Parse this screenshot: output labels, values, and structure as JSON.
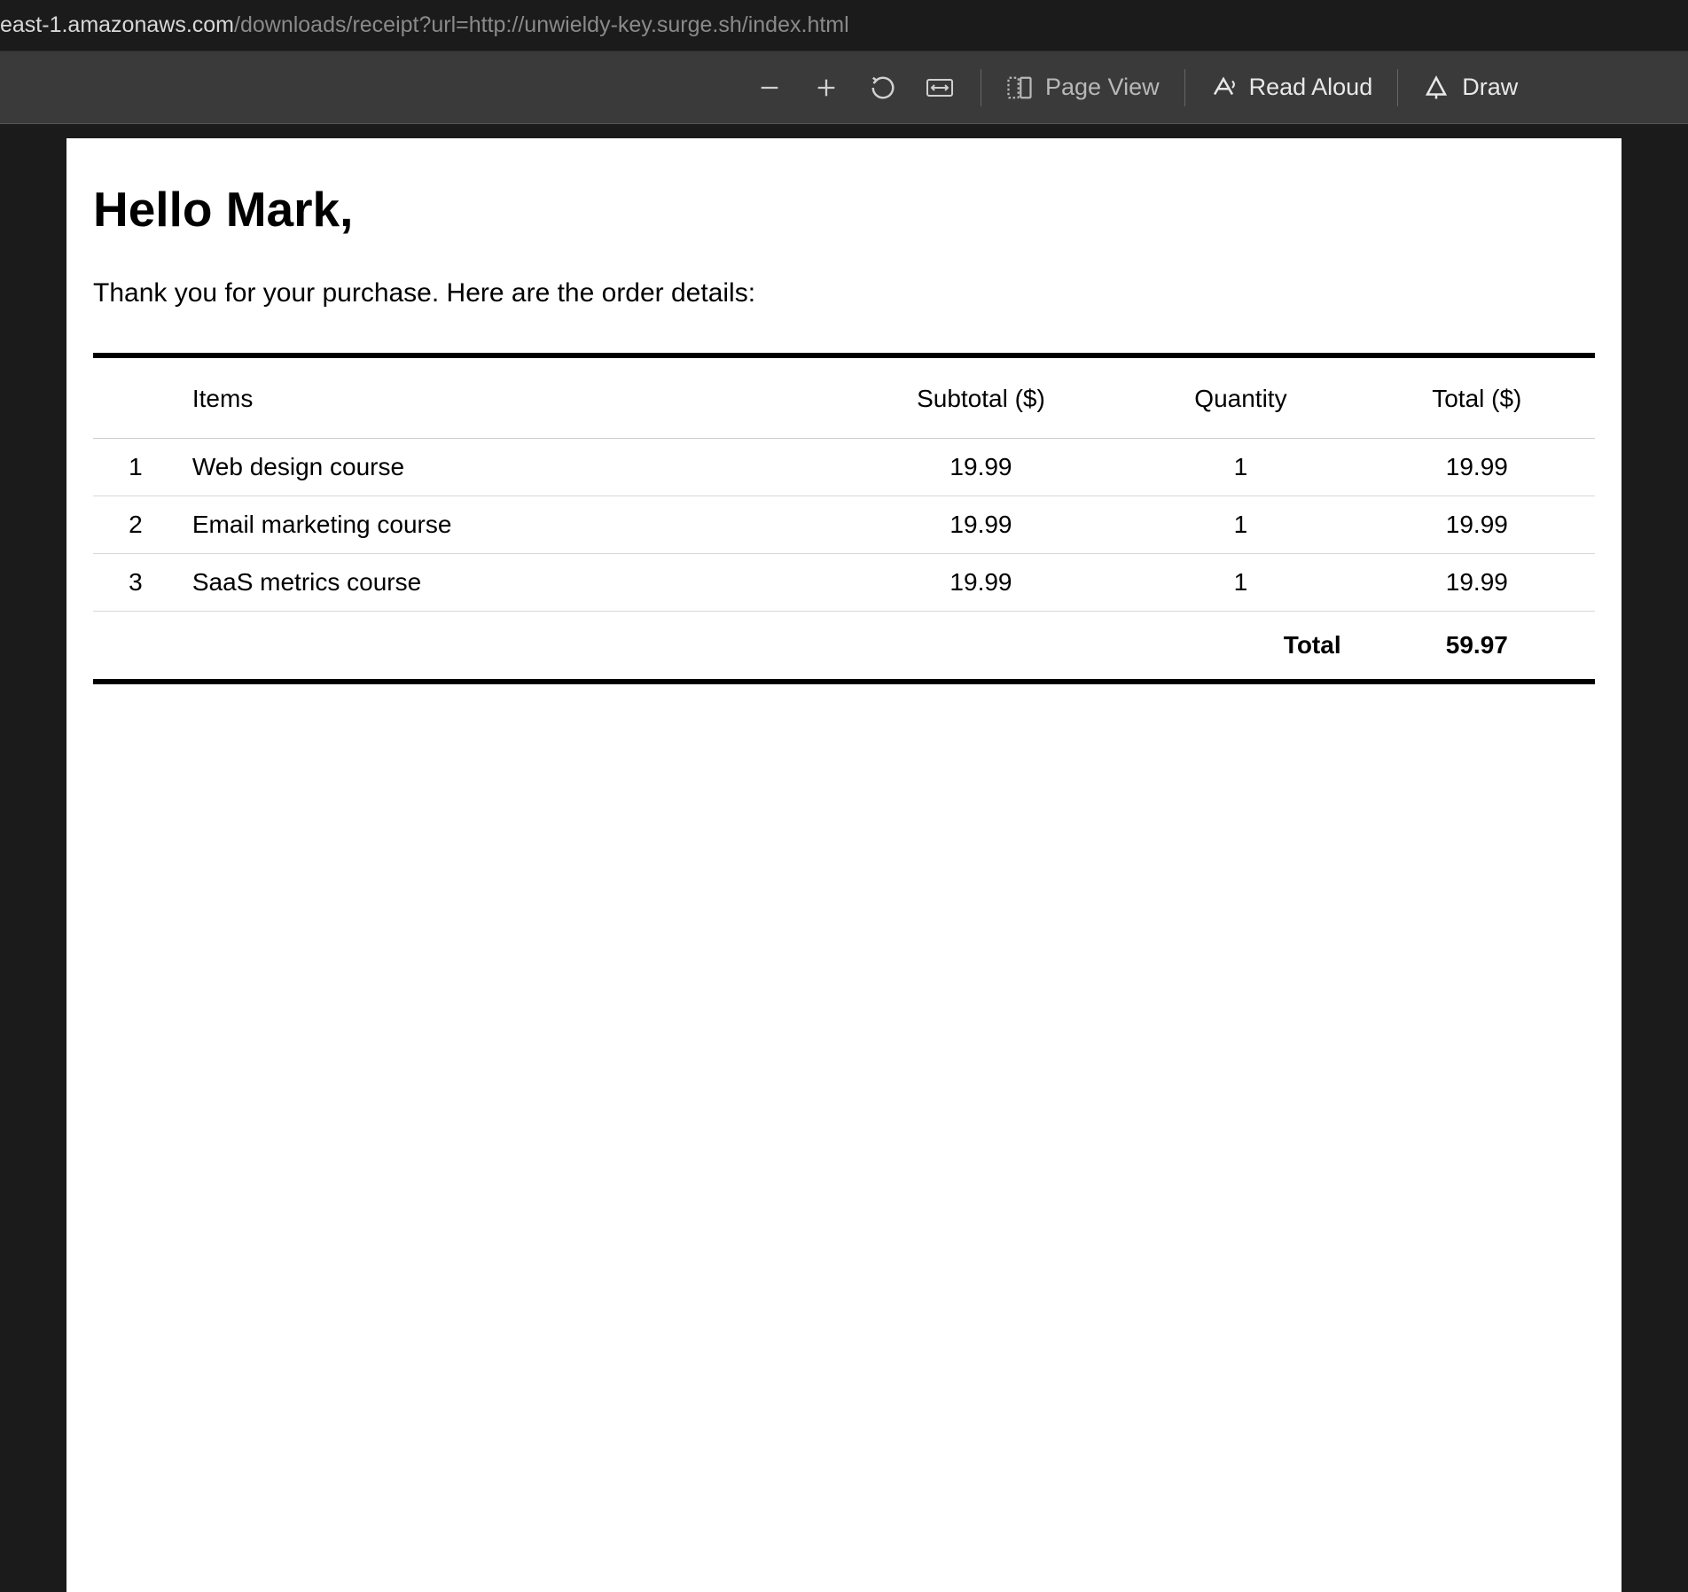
{
  "url": {
    "host": "east-1.amazonaws.com",
    "path": "/downloads/receipt?url=http://unwieldy-key.surge.sh/index.html"
  },
  "toolbar": {
    "page_view_label": "Page View",
    "read_aloud_label": "Read Aloud",
    "draw_label": "Draw"
  },
  "document": {
    "greeting": "Hello Mark,",
    "intro": "Thank you for your purchase. Here are the order details:",
    "headers": {
      "items": "Items",
      "subtotal": "Subtotal ($)",
      "quantity": "Quantity",
      "total": "Total ($)"
    },
    "rows": [
      {
        "idx": "1",
        "item": "Web design course",
        "subtotal": "19.99",
        "qty": "1",
        "total": "19.99"
      },
      {
        "idx": "2",
        "item": "Email marketing course",
        "subtotal": "19.99",
        "qty": "1",
        "total": "19.99"
      },
      {
        "idx": "3",
        "item": "SaaS metrics course",
        "subtotal": "19.99",
        "qty": "1",
        "total": "19.99"
      }
    ],
    "footer": {
      "label": "Total",
      "value": "59.97"
    }
  }
}
